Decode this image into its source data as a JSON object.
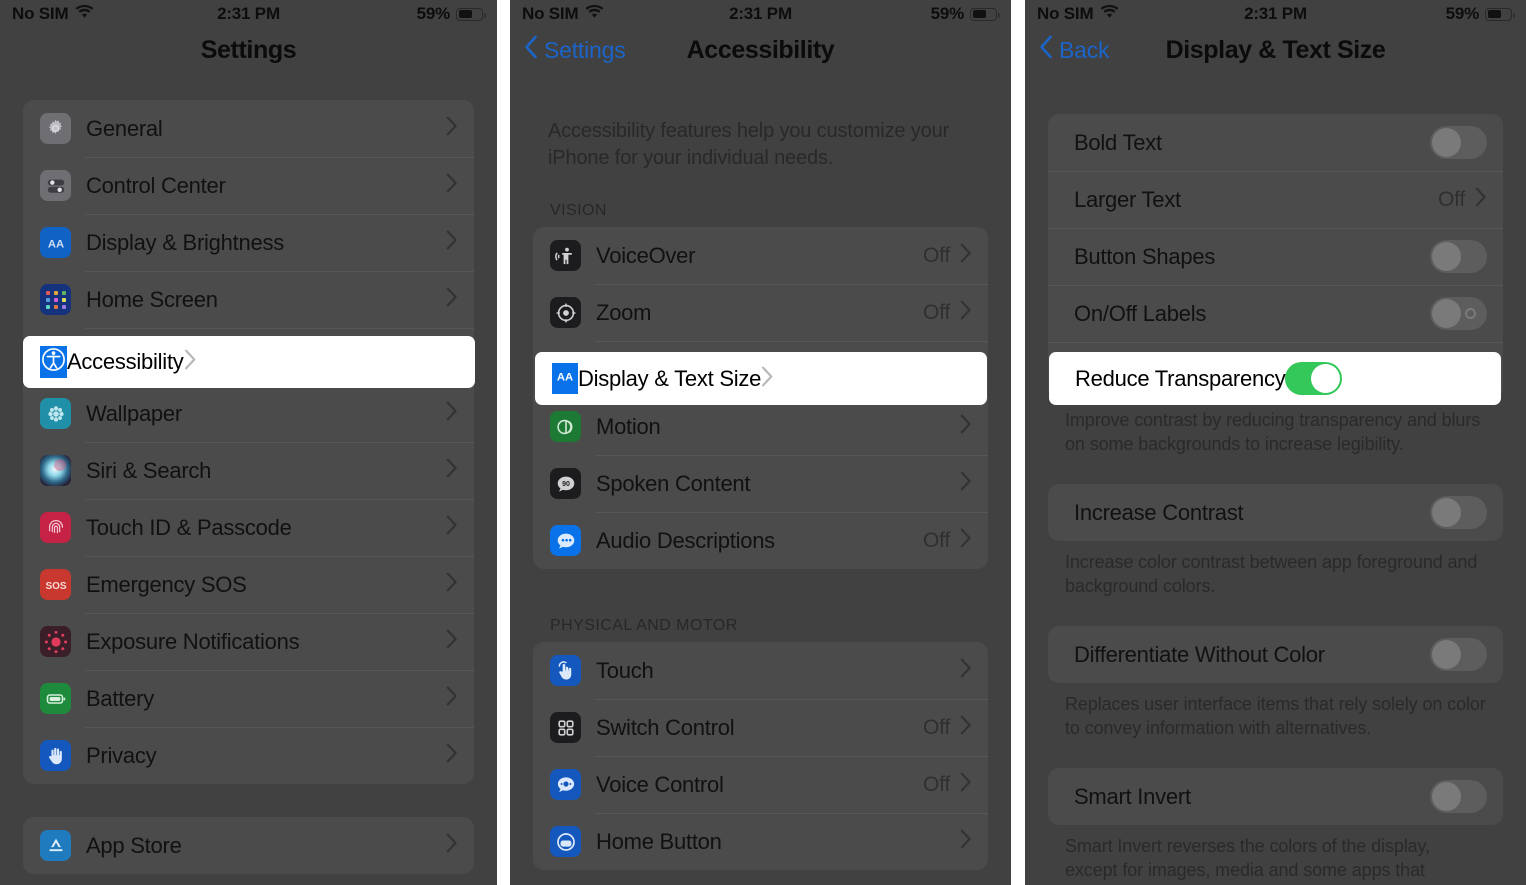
{
  "statusbar": {
    "carrier": "No SIM",
    "wifi_icon": "wifi-icon",
    "time": "2:31 PM",
    "battery_percent": "59%",
    "battery_icon": "battery-icon"
  },
  "colors": {
    "dim_background": "#414141",
    "accent_blue": "#1b64c8",
    "toggle_on_green": "#34c759",
    "highlight_white": "#ffffff",
    "icon_blue": "#0a72e8",
    "icon_green": "#1d8a3c",
    "icon_red": "#d7343a",
    "icon_gray": "#6e6e73",
    "icon_teal": "#2090a8",
    "icon_pink": "#e2335f"
  },
  "panel1": {
    "title": "Settings",
    "groups": [
      {
        "rows": [
          {
            "label": "General",
            "icon": "gear-icon",
            "icon_color": "#6e6e73",
            "accessory": "chevron",
            "value": ""
          },
          {
            "label": "Control Center",
            "icon": "control-center-icon",
            "icon_color": "#6e6e73",
            "accessory": "chevron",
            "value": ""
          },
          {
            "label": "Display & Brightness",
            "icon": "display-brightness-icon",
            "icon_color": "#1062c4",
            "accessory": "chevron",
            "value": ""
          },
          {
            "label": "Home Screen",
            "icon": "home-screen-icon",
            "icon_color": "#15327c",
            "accessory": "chevron",
            "value": ""
          },
          {
            "label": "Accessibility",
            "icon": "accessibility-icon",
            "icon_color": "#0a72e8",
            "accessory": "chevron",
            "value": "",
            "highlighted": true
          },
          {
            "label": "Wallpaper",
            "icon": "wallpaper-icon",
            "icon_color": "#2090a8",
            "accessory": "chevron",
            "value": ""
          },
          {
            "label": "Siri & Search",
            "icon": "siri-icon",
            "icon_color": "#2b2135",
            "accessory": "chevron",
            "value": ""
          },
          {
            "label": "Touch ID & Passcode",
            "icon": "touch-id-icon",
            "icon_color": "#c62246",
            "accessory": "chevron",
            "value": ""
          },
          {
            "label": "Emergency SOS",
            "icon": "emergency-sos-icon",
            "icon_color": "#c8382e",
            "accessory": "chevron",
            "value": ""
          },
          {
            "label": "Exposure Notifications",
            "icon": "exposure-notifications-icon",
            "icon_color": "#c62246",
            "accessory": "chevron",
            "value": ""
          },
          {
            "label": "Battery",
            "icon": "battery-app-icon",
            "icon_color": "#1d8a3c",
            "accessory": "chevron",
            "value": ""
          },
          {
            "label": "Privacy",
            "icon": "privacy-hand-icon",
            "icon_color": "#1558bd",
            "accessory": "chevron",
            "value": ""
          }
        ]
      },
      {
        "rows": [
          {
            "label": "App Store",
            "icon": "app-store-icon",
            "icon_color": "#1f7bbd",
            "accessory": "chevron",
            "value": ""
          }
        ]
      }
    ]
  },
  "panel2": {
    "back_label": "Settings",
    "title": "Accessibility",
    "intro": "Accessibility features help you customize your iPhone for your individual needs.",
    "sections": [
      {
        "header": "VISION",
        "rows": [
          {
            "label": "VoiceOver",
            "icon": "voiceover-icon",
            "icon_color": "#1c1c1e",
            "value": "Off",
            "accessory": "chevron"
          },
          {
            "label": "Zoom",
            "icon": "zoom-icon",
            "icon_color": "#1c1c1e",
            "value": "Off",
            "accessory": "chevron"
          },
          {
            "label": "Display & Text Size",
            "icon": "display-text-size-icon",
            "icon_color": "#0a72e8",
            "value": "",
            "accessory": "chevron",
            "highlighted": true
          },
          {
            "label": "Motion",
            "icon": "motion-icon",
            "icon_color": "#1d7a35",
            "value": "",
            "accessory": "chevron"
          },
          {
            "label": "Spoken Content",
            "icon": "spoken-content-icon",
            "icon_color": "#1c1c1e",
            "value": "",
            "accessory": "chevron"
          },
          {
            "label": "Audio Descriptions",
            "icon": "audio-descriptions-icon",
            "icon_color": "#0a72e8",
            "value": "Off",
            "accessory": "chevron"
          }
        ]
      },
      {
        "header": "PHYSICAL AND MOTOR",
        "rows": [
          {
            "label": "Touch",
            "icon": "touch-icon",
            "icon_color": "#1558bd",
            "value": "",
            "accessory": "chevron"
          },
          {
            "label": "Switch Control",
            "icon": "switch-control-icon",
            "icon_color": "#1c1c1e",
            "value": "Off",
            "accessory": "chevron"
          },
          {
            "label": "Voice Control",
            "icon": "voice-control-icon",
            "icon_color": "#1558bd",
            "value": "Off",
            "accessory": "chevron"
          },
          {
            "label": "Home Button",
            "icon": "home-button-icon",
            "icon_color": "#1558bd",
            "value": "",
            "accessory": "chevron"
          }
        ]
      }
    ]
  },
  "panel3": {
    "back_label": "Back",
    "title": "Display & Text Size",
    "rows": [
      {
        "label": "Bold Text",
        "accessory": "toggle",
        "toggle_on": false,
        "value": ""
      },
      {
        "label": "Larger Text",
        "accessory": "chevron",
        "value": "Off",
        "toggle_on": false
      },
      {
        "label": "Button Shapes",
        "accessory": "toggle",
        "toggle_on": false,
        "value": ""
      },
      {
        "label": "On/Off Labels",
        "accessory": "toggle-labels",
        "toggle_on": false,
        "value": ""
      },
      {
        "label": "Reduce Transparency",
        "accessory": "toggle",
        "toggle_on": true,
        "value": "",
        "highlighted": true
      }
    ],
    "footnotes": {
      "reduce_transparency": "Improve contrast by reducing transparency and blurs on some backgrounds to increase legibility.",
      "increase_contrast": "Increase color contrast between app foreground and background colors.",
      "differentiate_without_color": "Replaces user interface items that rely solely on color to convey information with alternatives.",
      "smart_invert": "Smart Invert reverses the colors of the display, except for images, media and some apps that"
    },
    "rows2": [
      {
        "label": "Increase Contrast",
        "accessory": "toggle",
        "toggle_on": false
      },
      {
        "label": "Differentiate Without Color",
        "accessory": "toggle",
        "toggle_on": false
      },
      {
        "label": "Smart Invert",
        "accessory": "toggle",
        "toggle_on": false
      }
    ]
  }
}
